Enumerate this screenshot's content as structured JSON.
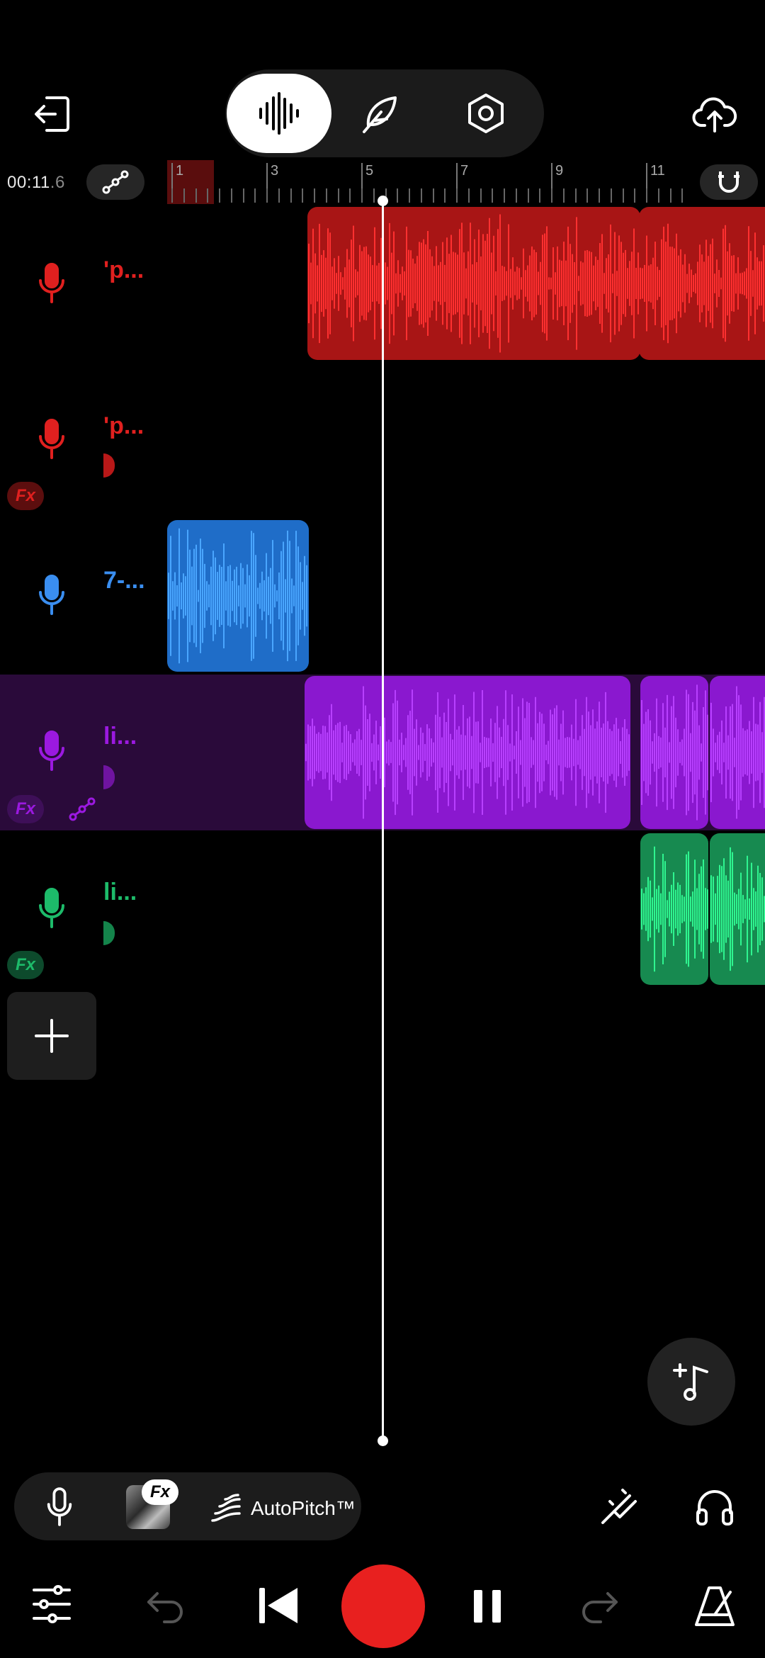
{
  "header": {
    "exit_icon": "exit-arrow-icon",
    "modes": [
      {
        "name": "waveform-mode",
        "icon": "waveform-icon",
        "active": true
      },
      {
        "name": "lyrics-mode",
        "icon": "feather-icon",
        "active": false
      },
      {
        "name": "settings-mode",
        "icon": "hex-nut-icon",
        "active": false
      }
    ],
    "upload_icon": "cloud-upload-icon"
  },
  "timeline": {
    "time_main": "00:11",
    "time_frac": ".6",
    "ruler_numbers": [
      "1",
      "3",
      "5",
      "7",
      "9",
      "11"
    ]
  },
  "tracks": [
    {
      "name": "'p...",
      "color": "#e0201f",
      "has_fx": false,
      "has_volume": false
    },
    {
      "name": "'p...",
      "color": "#e0201f",
      "has_fx": true,
      "has_volume": true
    },
    {
      "name": "7-...",
      "color": "#3a8ef0",
      "has_fx": false,
      "has_volume": false
    },
    {
      "name": "li...",
      "color": "#9b19e0",
      "has_fx": true,
      "has_volume": true,
      "selected": true
    },
    {
      "name": "li...",
      "color": "#1dbb6a",
      "has_fx": true,
      "has_volume": true
    }
  ],
  "fx_label": "Fx",
  "toolbar": {
    "autopitch_label": "AutoPitch™",
    "fx_badge": "Fx"
  },
  "colors": {
    "red": "#e0201f",
    "blue": "#3a8ef0",
    "purple": "#9b19e0",
    "green": "#1dbb6a",
    "record": "#e8201f"
  }
}
